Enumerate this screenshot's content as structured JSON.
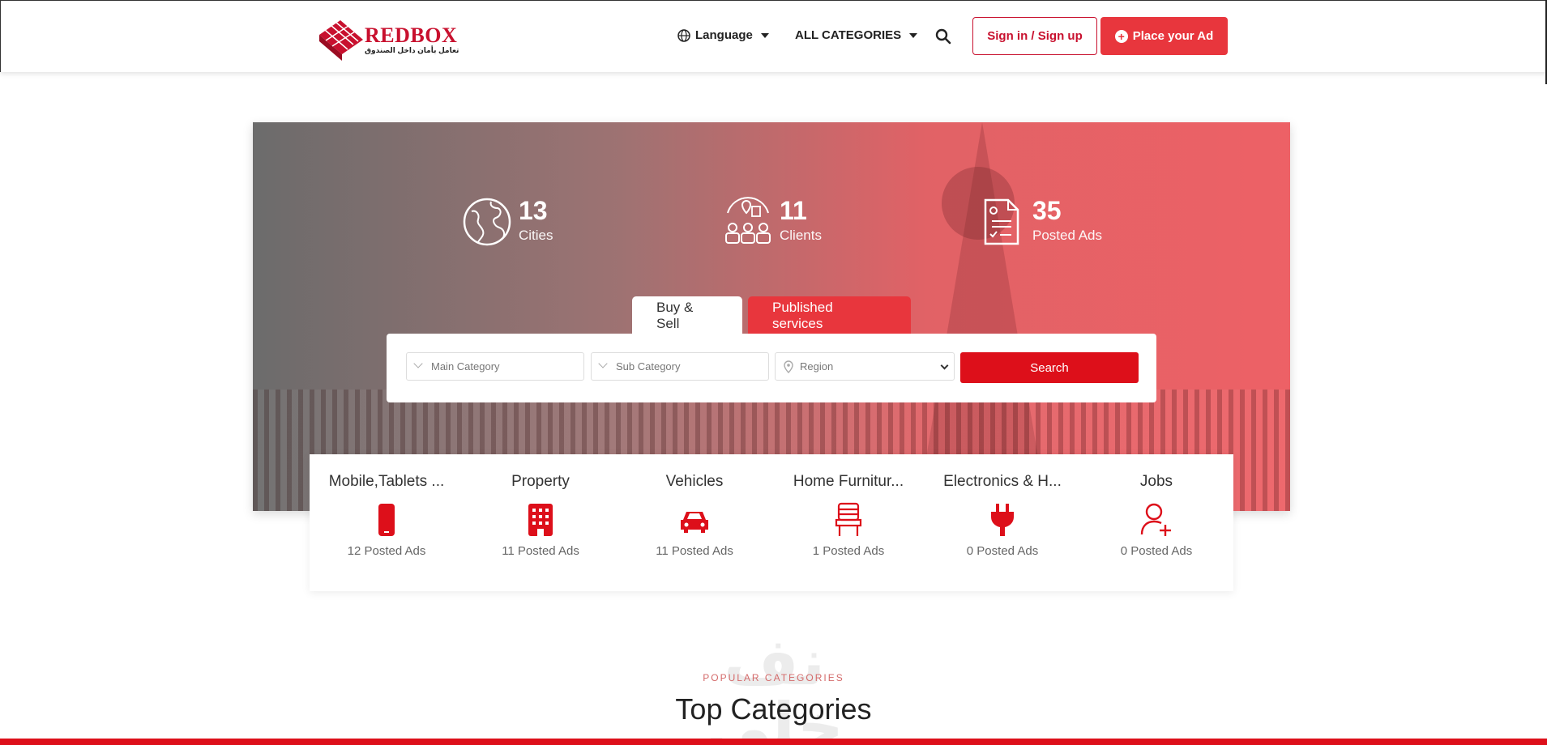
{
  "header": {
    "logo_text": "REDBOX",
    "logo_tagline": "تعامل بأمان داخل الصندوق",
    "language_label": "Language",
    "categories_label": "ALL CATEGORIES",
    "signin_label": "Sign in / Sign up",
    "place_ad_label": "Place your Ad"
  },
  "hero": {
    "stats": [
      {
        "value": "13",
        "label": "Cities",
        "icon": "globe-icon"
      },
      {
        "value": "11",
        "label": "Clients",
        "icon": "clients-icon"
      },
      {
        "value": "35",
        "label": "Posted Ads",
        "icon": "document-icon"
      }
    ],
    "tabs": [
      {
        "label": "Buy & Sell",
        "active": true
      },
      {
        "label": "Published services",
        "active": false
      }
    ],
    "search": {
      "main_category_placeholder": "Main Category",
      "sub_category_placeholder": "Sub Category",
      "region_placeholder": "Region",
      "submit_label": "Search"
    }
  },
  "categories": [
    {
      "title": "Mobile,Tablets ...",
      "count": "12 Posted Ads",
      "icon": "mobile-icon"
    },
    {
      "title": "Property",
      "count": "11 Posted Ads",
      "icon": "building-icon"
    },
    {
      "title": "Vehicles",
      "count": "11 Posted Ads",
      "icon": "car-icon"
    },
    {
      "title": "Home Furnitur...",
      "count": "1 Posted Ads",
      "icon": "chair-icon"
    },
    {
      "title": "Electronics & H...",
      "count": "0 Posted Ads",
      "icon": "plug-icon"
    },
    {
      "title": "Jobs",
      "count": "0 Posted Ads",
      "icon": "add-user-icon"
    }
  ],
  "popular": {
    "subtitle": "POPULAR CATEGORIES",
    "title": "Top Categories",
    "watermark": "نف خلي"
  },
  "colors": {
    "brand_red": "#e8363d",
    "search_red": "#dd0f1a",
    "logo_red": "#c8102e"
  }
}
